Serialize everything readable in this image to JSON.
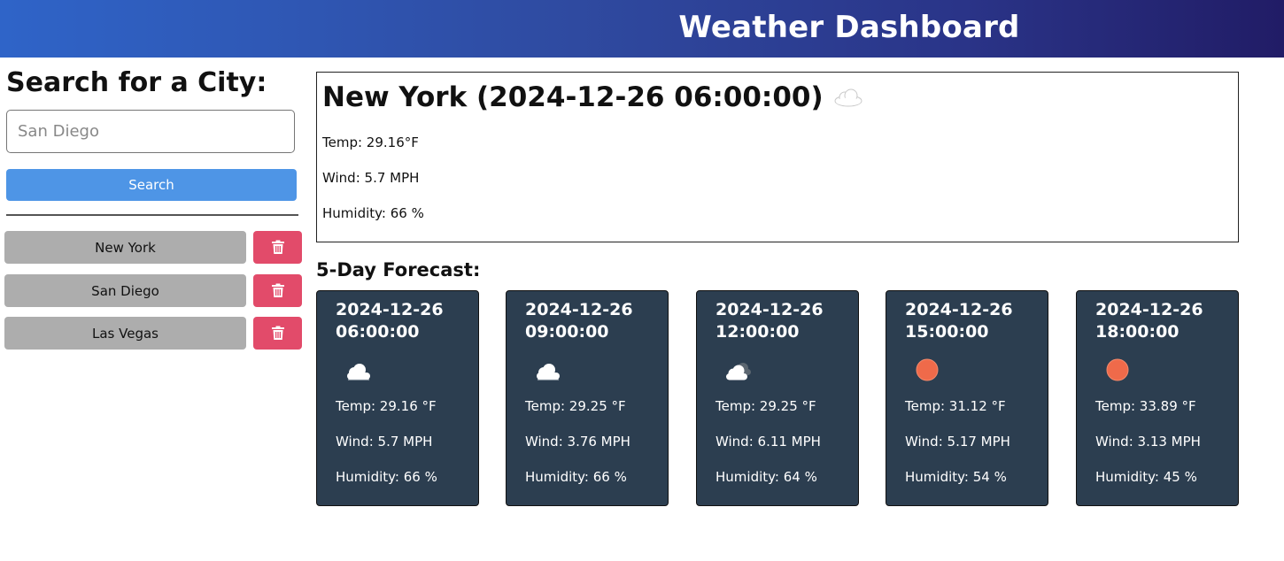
{
  "header": {
    "title": "Weather Dashboard"
  },
  "search": {
    "heading": "Search for a City:",
    "input_value": "",
    "placeholder": "San Diego",
    "button_label": "Search"
  },
  "history": [
    {
      "city": "New York"
    },
    {
      "city": "San Diego"
    },
    {
      "city": "Las Vegas"
    }
  ],
  "current": {
    "title": "New York (2024-12-26 06:00:00)",
    "icon": "cloud-icon",
    "temp": "Temp: 29.16°F",
    "wind": "Wind: 5.7 MPH",
    "humidity": "Humidity: 66 %"
  },
  "forecast": {
    "heading": "5-Day Forecast:",
    "cards": [
      {
        "date": "2024-12-26 06:00:00",
        "icon": "cloud-icon",
        "temp": "Temp: 29.16 °F",
        "wind": "Wind: 5.7 MPH",
        "humidity": "Humidity: 66 %"
      },
      {
        "date": "2024-12-26 09:00:00",
        "icon": "cloud-icon",
        "temp": "Temp: 29.25 °F",
        "wind": "Wind: 3.76 MPH",
        "humidity": "Humidity: 66 %"
      },
      {
        "date": "2024-12-26 12:00:00",
        "icon": "broken-clouds-icon",
        "temp": "Temp: 29.25 °F",
        "wind": "Wind: 6.11 MPH",
        "humidity": "Humidity: 64 %"
      },
      {
        "date": "2024-12-26 15:00:00",
        "icon": "sun-icon",
        "temp": "Temp: 31.12 °F",
        "wind": "Wind: 5.17 MPH",
        "humidity": "Humidity: 54 %"
      },
      {
        "date": "2024-12-26 18:00:00",
        "icon": "sun-icon",
        "temp": "Temp: 33.89 °F",
        "wind": "Wind: 3.13 MPH",
        "humidity": "Humidity: 45 %"
      }
    ]
  },
  "colors": {
    "header_start": "#2f64c8",
    "header_end": "#211c66",
    "search_button": "#4e95e6",
    "history_button": "#adadad",
    "delete_button": "#e24b6a",
    "card_background": "#2c3e50",
    "sun": "#ef6a4a"
  },
  "icons": {
    "delete": "trash-icon"
  }
}
